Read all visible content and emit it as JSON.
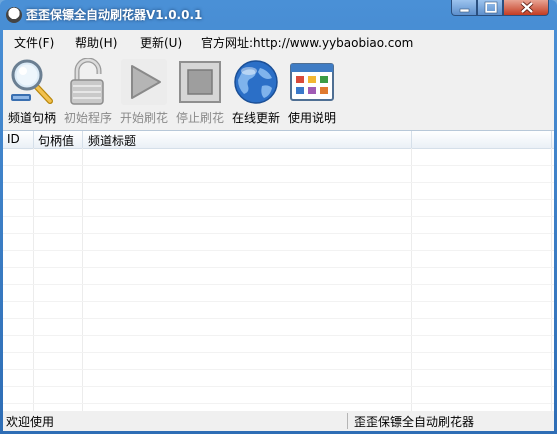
{
  "window": {
    "title": "歪歪保镖全自动刷花器V1.0.0.1",
    "controls": {
      "minimize": "minimize-icon",
      "maximize": "maximize-icon",
      "close": "close-icon"
    }
  },
  "menu": {
    "file": "文件(F)",
    "help": "帮助(H)",
    "update": "更新(U)",
    "website": "官方网址:http://www.yybaobiao.com"
  },
  "toolbar": {
    "items": [
      {
        "label": "频道句柄",
        "icon": "magnifier-icon",
        "enabled": true
      },
      {
        "label": "初始程序",
        "icon": "padlock-icon",
        "enabled": false
      },
      {
        "label": "开始刷花",
        "icon": "play-icon",
        "enabled": false
      },
      {
        "label": "停止刷花",
        "icon": "stop-icon",
        "enabled": false
      },
      {
        "label": "在线更新",
        "icon": "globe-icon",
        "enabled": true
      },
      {
        "label": "使用说明",
        "icon": "window-icon",
        "enabled": true
      }
    ]
  },
  "table": {
    "columns": [
      "ID",
      "句柄值",
      "频道标题"
    ],
    "rows": []
  },
  "status": {
    "left": "欢迎使用",
    "right": "歪歪保镖全自动刷花器"
  },
  "colors": {
    "title_bar": "#3a7ec6",
    "client_bg": "#f0f0f0",
    "disabled_text": "#8a8a8a"
  }
}
